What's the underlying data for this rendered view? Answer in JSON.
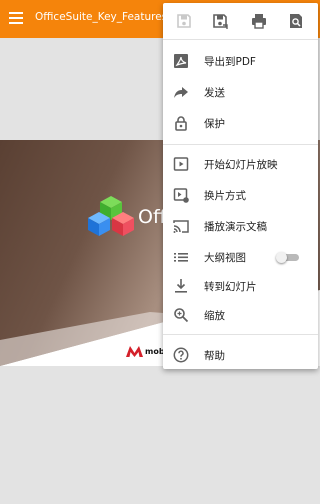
{
  "app_bar": {
    "title": "OfficeSuite_Key_Features.pps",
    "menu_icon": "hamburger-menu-icon",
    "background_color": "#f5840b"
  },
  "slide": {
    "logo_text": "Offi",
    "brand_text": "mobi"
  },
  "menu": {
    "toolbar": [
      {
        "icon": "save-icon",
        "enabled": false
      },
      {
        "icon": "save-as-icon",
        "enabled": true
      },
      {
        "icon": "print-icon",
        "enabled": true
      },
      {
        "icon": "find-icon",
        "enabled": true
      }
    ],
    "items": [
      {
        "label": "导出到PDF",
        "icon": "pdf-icon"
      },
      {
        "label": "发送",
        "icon": "share-icon"
      },
      {
        "label": "保护",
        "icon": "lock-icon"
      },
      {
        "label": "开始幻灯片放映",
        "icon": "slideshow-play-icon"
      },
      {
        "label": "换片方式",
        "icon": "transition-icon"
      },
      {
        "label": "播放演示文稿",
        "icon": "cast-icon"
      },
      {
        "label": "大纲视图",
        "icon": "outline-icon",
        "toggle": false
      },
      {
        "label": "转到幻灯片",
        "icon": "go-to-slide-icon"
      },
      {
        "label": "缩放",
        "icon": "zoom-icon"
      },
      {
        "label": "帮助",
        "icon": "help-icon"
      }
    ]
  }
}
